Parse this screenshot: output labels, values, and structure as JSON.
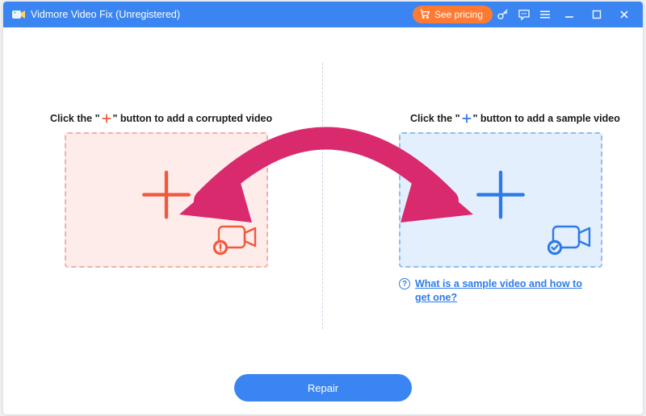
{
  "titlebar": {
    "app_name": "Vidmore Video Fix (Unregistered)",
    "pricing_label": "See pricing"
  },
  "left": {
    "instruction_pre": "Click the \"",
    "instruction_post": "\" button to add a corrupted video"
  },
  "right": {
    "instruction_pre": "Click the \"",
    "instruction_post": "\" button to add a sample video"
  },
  "help": {
    "text": "What is a sample video and how to get one?"
  },
  "actions": {
    "repair_label": "Repair"
  },
  "colors": {
    "accent": "#3a85f2",
    "pricing": "#ff7a33",
    "left_stroke": "#f05a3e",
    "right_stroke": "#2d7be9",
    "arrow": "#d92a6e"
  }
}
